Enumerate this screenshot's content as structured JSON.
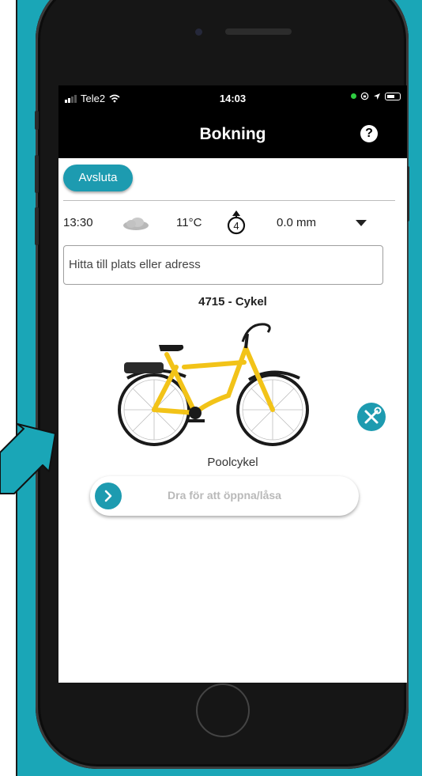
{
  "status_bar": {
    "carrier": "Tele2",
    "time": "14:03"
  },
  "nav": {
    "title": "Bokning",
    "help_label": "?"
  },
  "booking": {
    "end_button": "Avsluta",
    "weather": {
      "time": "13:30",
      "condition_icon": "cloud-icon",
      "temperature": "11°C",
      "uv_index": "4",
      "precipitation": "0.0 mm"
    },
    "search": {
      "placeholder": "Hitta till plats eller adress"
    },
    "bike": {
      "title": "4715 - Cykel",
      "type": "Poolcykel",
      "frame_color": "#f2c318"
    },
    "slider": {
      "label": "Dra för att öppna/låsa"
    }
  },
  "colors": {
    "accent": "#1d9bb0",
    "background": "#1aa6b7"
  }
}
